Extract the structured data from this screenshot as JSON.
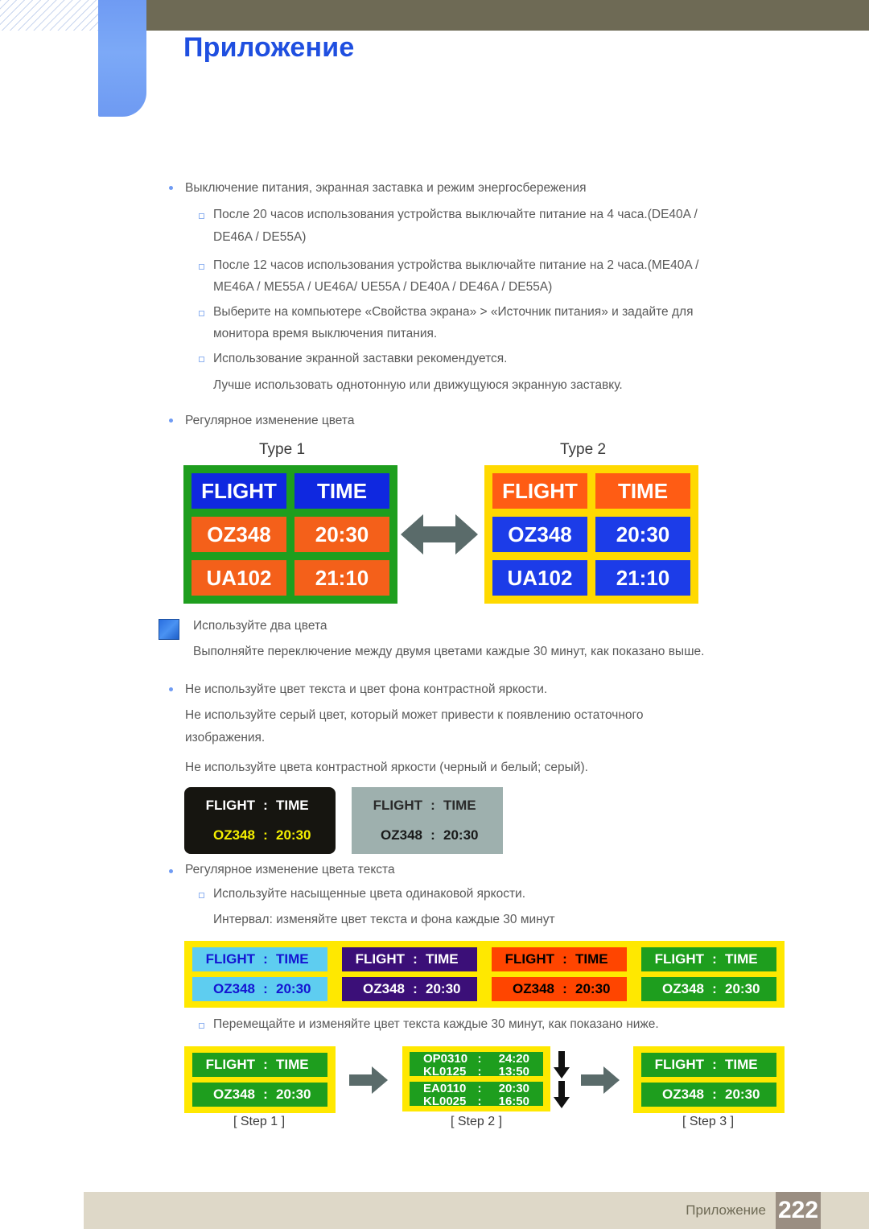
{
  "header": {
    "title": "Приложение"
  },
  "body": {
    "b1": "Выключение питания, экранная заставка и режим энергосбережения",
    "s1": "После 20 часов использования устройства выключайте питание на 4 часа.(DE40A /",
    "s1b": "DE46A / DE55A)",
    "s2": "После 12 часов использования устройства выключайте питание на 2 часа.(ME40A /",
    "s2b": "ME46A / ME55A / UE46A/ UE55A / DE40A / DE46A / DE55A)",
    "s3": "Выберите на компьютере «Свойства экрана» > «Источник питания» и задайте для",
    "s3b": "монитора время выключения питания.",
    "s4": "Использование экранной заставки рекомендуется.",
    "s4b": "Лучше использовать однотонную или движущуюся экранную заставку.",
    "b2": "Регулярное изменение цвета",
    "note1": "Используйте два цвета",
    "note2": "Выполняйте переключение между двумя цветами каждые 30 минут, как показано выше.",
    "b3": "Не используйте цвет текста и цвет фона контрастной яркости.",
    "b3a": "Не используйте серый цвет, который может привести к появлению остаточного",
    "b3b": "изображения.",
    "b3c": "Не используйте цвета контрастной яркости (черный и белый; серый).",
    "b4": "Регулярное изменение цвета текста",
    "s5": "Используйте насыщенные цвета одинаковой яркости.",
    "s5b": "Интервал: изменяйте цвет текста и фона каждые 30 минут",
    "s6": "Перемещайте и изменяйте цвет текста каждые 30 минут, как показано ниже."
  },
  "boards": {
    "type1_label": "Type 1",
    "type2_label": "Type 2",
    "cells": {
      "flight": "FLIGHT",
      "time": "TIME",
      "oz": "OZ348",
      "oz_time": "20:30",
      "ua": "UA102",
      "ua_time": "21:10",
      "colon": ":"
    },
    "type1": {
      "border": "#1e9e1e",
      "header_bg": "#0f28e0",
      "data_bg": "#f4601a",
      "text": "#ffffff"
    },
    "type2": {
      "border": "#ffd900",
      "header_bg": "#ff5c14",
      "data_bg": "#1c3ce8",
      "text": "#ffffff"
    }
  },
  "contrast_boards": [
    {
      "name": "black-board",
      "bg": "#161510",
      "header_text": "#ffffff",
      "data_text": "#f5f000"
    },
    {
      "name": "gray-board",
      "bg": "#9eb0ae",
      "header_text": "#2a2a2a",
      "data_text": "#1a1a1a"
    }
  ],
  "color_boards": [
    {
      "name": "cyan-board",
      "frame": "#ffe800",
      "bg": "#5ecdf0",
      "text": "#1414d2"
    },
    {
      "name": "purple-board",
      "frame": "#ffe800",
      "bg": "#3b0f78",
      "text": "#ffffff"
    },
    {
      "name": "orange-board",
      "frame": "#ffe800",
      "bg": "#ff4500",
      "text": "#000000"
    },
    {
      "name": "green-board",
      "frame": "#ffe800",
      "bg": "#1e9e1e",
      "text": "#ffffff"
    }
  ],
  "steps": {
    "step1_caption": "[ Step 1 ]",
    "step2_caption": "[ Step 2 ]",
    "step3_caption": "[ Step 3 ]",
    "frame": "#ffe800",
    "bg": "#1e9e1e",
    "text": "#ffffff",
    "scroll": [
      {
        "flight": "OP0310",
        "time": "24:20"
      },
      {
        "flight": "KL0125",
        "time": "13:50"
      },
      {
        "flight": "EA0110",
        "time": "20:30"
      },
      {
        "flight": "KL0025",
        "time": "16:50"
      }
    ]
  },
  "footer": {
    "label": "Приложение",
    "page": "222"
  }
}
